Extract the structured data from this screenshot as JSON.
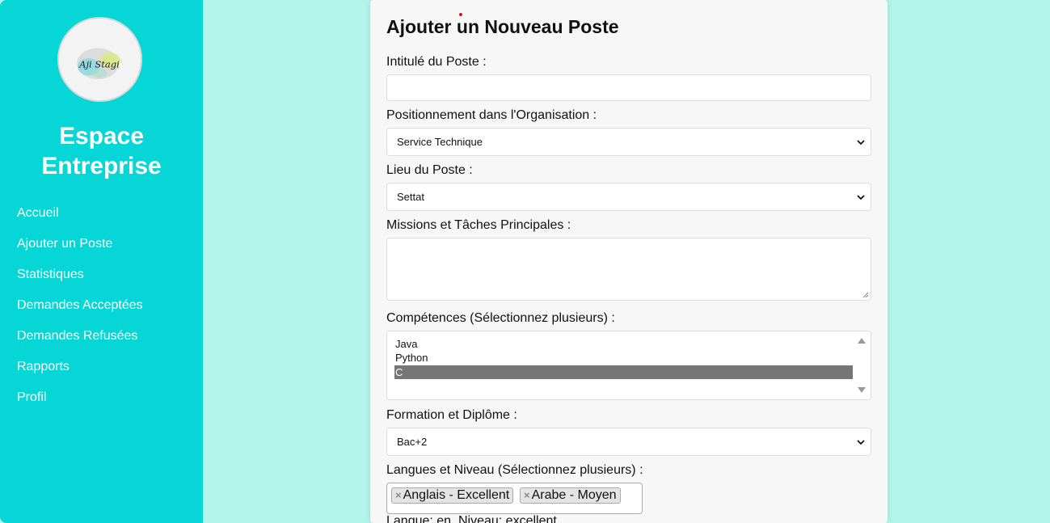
{
  "sidebar": {
    "logo_text": "Aji Stagi",
    "brand_line1": "Espace",
    "brand_line2": "Entreprise",
    "items": [
      {
        "label": "Accueil"
      },
      {
        "label": "Ajouter un Poste"
      },
      {
        "label": "Statistiques"
      },
      {
        "label": "Demandes Acceptées"
      },
      {
        "label": "Demandes Refusées"
      },
      {
        "label": "Rapports"
      },
      {
        "label": "Profil"
      }
    ]
  },
  "form": {
    "title": "Ajouter un Nouveau Poste",
    "intitule_label": "Intitulé du Poste :",
    "intitule_value": "",
    "position_label": "Positionnement dans l'Organisation :",
    "position_value": "Service Technique",
    "lieu_label": "Lieu du Poste :",
    "lieu_value": "Settat",
    "missions_label": "Missions et Tâches Principales :",
    "missions_value": "",
    "competences_label": "Compétences (Sélectionnez plusieurs) :",
    "competences_options": [
      {
        "label": "Java",
        "selected": false
      },
      {
        "label": "Python",
        "selected": false
      },
      {
        "label": "C",
        "selected": true
      }
    ],
    "formation_label": "Formation et Diplôme :",
    "formation_value": "Bac+2",
    "langues_label": "Langues et Niveau (Sélectionnez plusieurs) :",
    "langues_tags": [
      {
        "label": "Anglais - Excellent",
        "remove": "×"
      },
      {
        "label": "Arabe - Moyen",
        "remove": "×"
      }
    ],
    "langues_info": "Langue: en, Niveau: excellent"
  },
  "colors": {
    "sidebar_bg": "#07d6d6",
    "page_bg": "#b3f5ea",
    "card_bg": "#f7f7f7",
    "selected_option_bg": "#767676"
  },
  "icons": {
    "select_arrow": "chevron-down-icon",
    "textarea_resize": "resize-handle-icon",
    "scroll_up": "scroll-up-icon",
    "scroll_down": "scroll-down-icon",
    "tag_remove": "close-icon"
  }
}
